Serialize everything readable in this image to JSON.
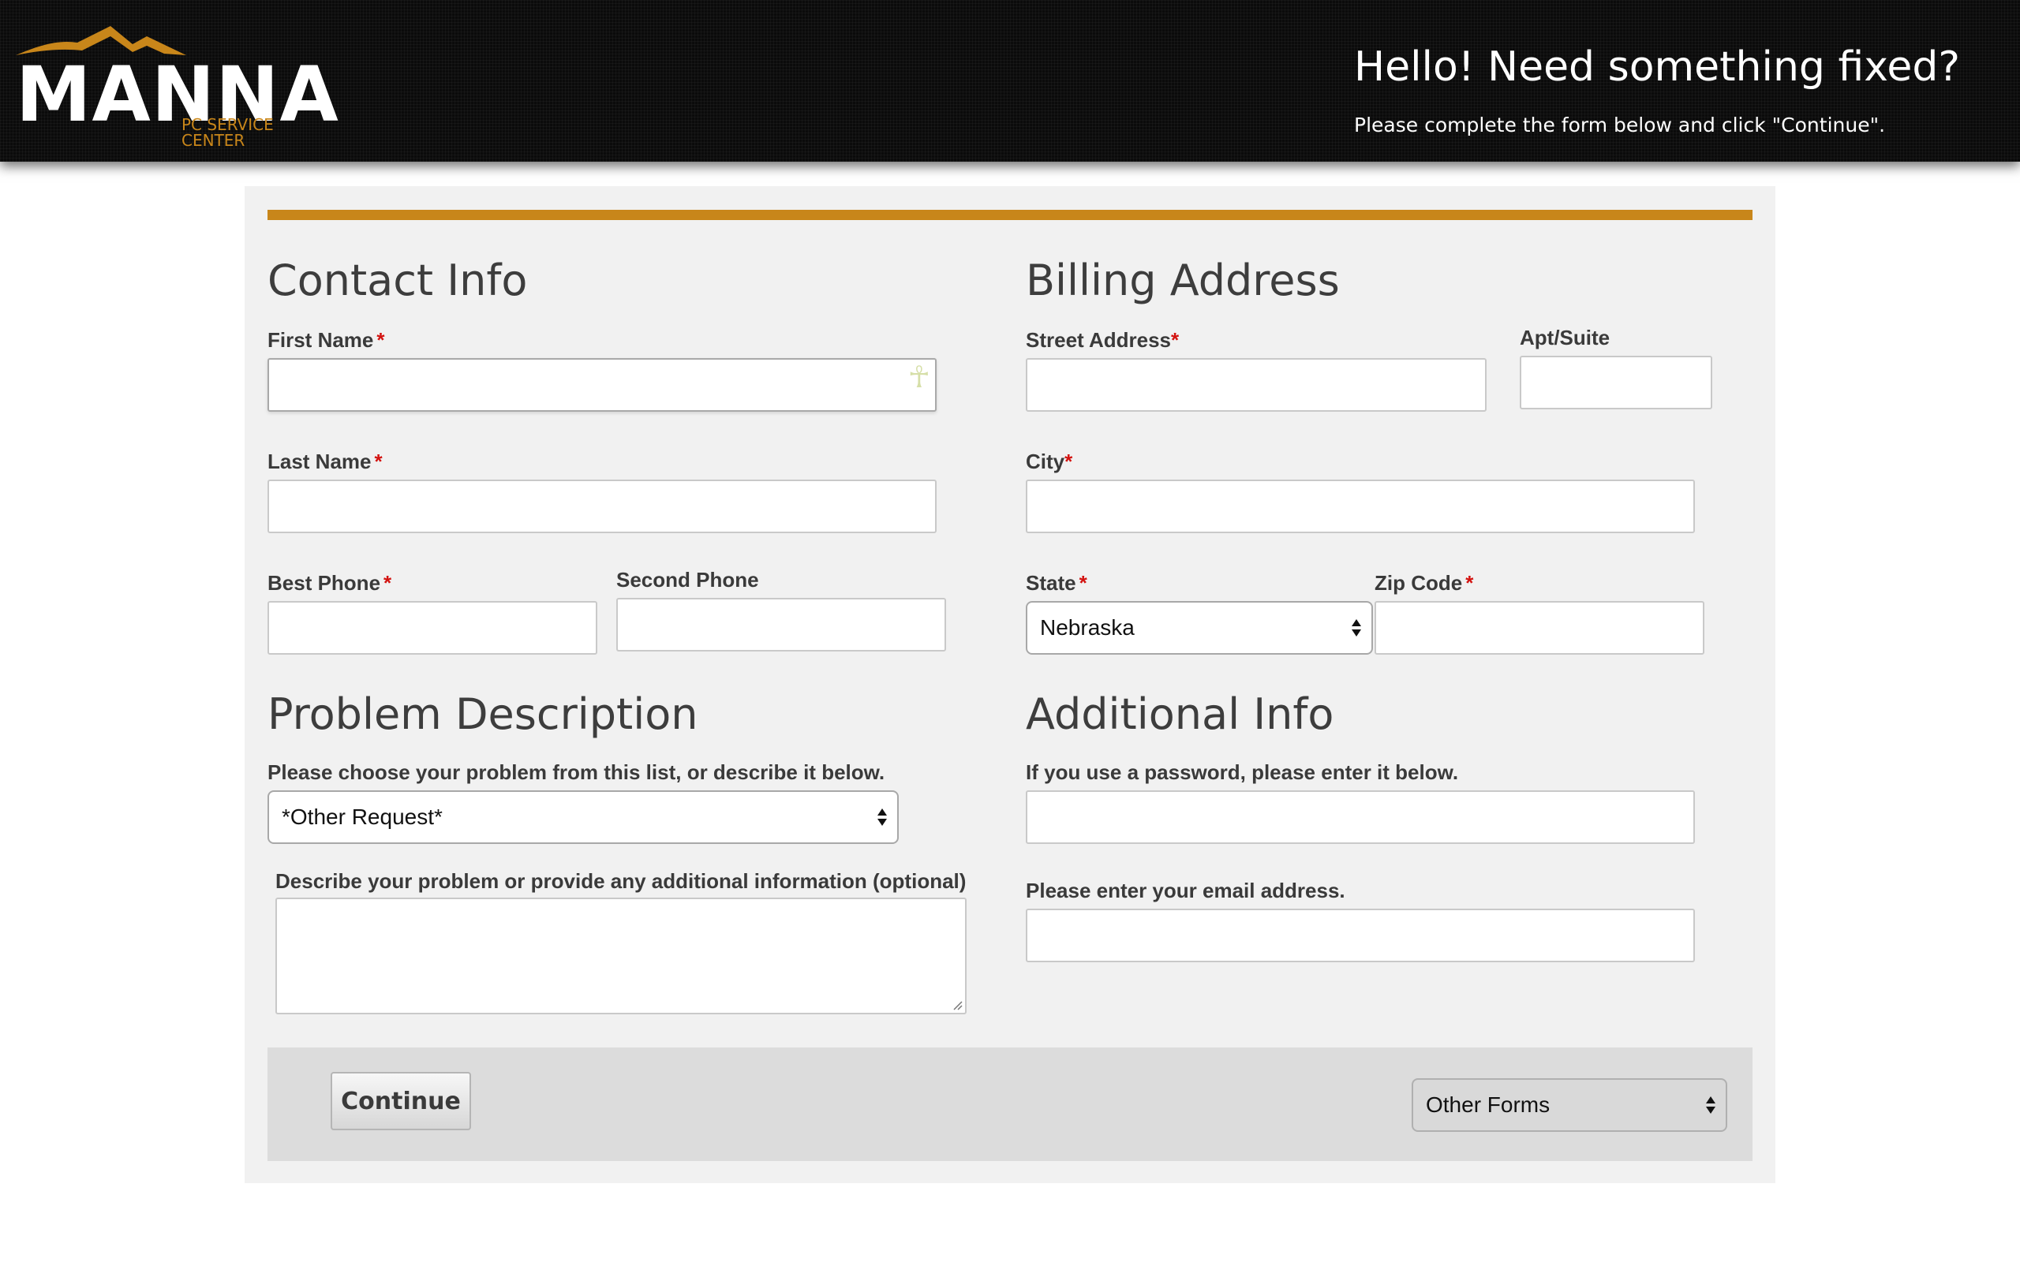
{
  "header": {
    "logo_text": "MANNA",
    "logo_subtitle": "PC SERVICE CENTER",
    "greeting": "Hello! Need something fixed?",
    "instruction": "Please complete the form below and click \"Continue\"."
  },
  "colors": {
    "accent": "#c8861a",
    "required": "#d3120f",
    "header_bg": "#0b0b0b",
    "panel_bg": "#f1f1f1"
  },
  "contact": {
    "title": "Contact Info",
    "first_name_label": "First Name",
    "last_name_label": "Last Name",
    "best_phone_label": "Best Phone",
    "second_phone_label": "Second Phone",
    "required_mark": "*"
  },
  "billing": {
    "title": "Billing Address",
    "street_label": "Street Address",
    "apt_label": "Apt/Suite",
    "city_label": "City",
    "state_label": "State",
    "state_value": "Nebraska",
    "zip_label": "Zip Code"
  },
  "problem": {
    "title": "Problem Description",
    "choose_label": "Please choose your problem from this list, or describe it below.",
    "choose_value": "*Other Request*",
    "describe_label": "Describe your problem or provide any additional information (optional)"
  },
  "additional": {
    "title": "Additional Info",
    "password_label": "If you use a password, please enter it below.",
    "email_label": "Please enter your email address."
  },
  "footer": {
    "continue_label": "Continue",
    "other_forms_value": "Other Forms"
  },
  "icons": {
    "ankh": "☥"
  }
}
